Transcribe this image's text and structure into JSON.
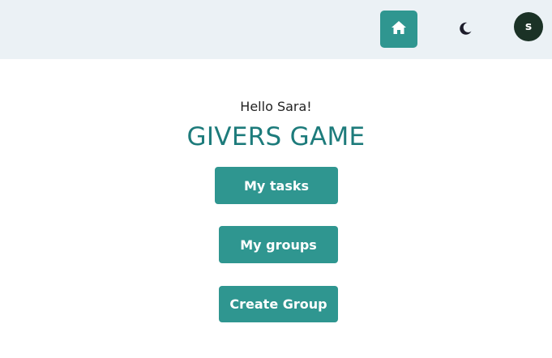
{
  "header": {
    "home_icon": "home-icon",
    "theme_icon": "moon-icon",
    "avatar_initial": "s"
  },
  "main": {
    "greeting": "Hello Sara!",
    "title": "GIVERS GAME",
    "buttons": {
      "my_tasks": "My tasks",
      "my_groups": "My groups",
      "create_group": "Create Group"
    }
  },
  "colors": {
    "accent": "#2f9690",
    "title": "#1d7b7b",
    "header_bg": "#ebf1f5",
    "avatar_bg": "#1b3226"
  }
}
